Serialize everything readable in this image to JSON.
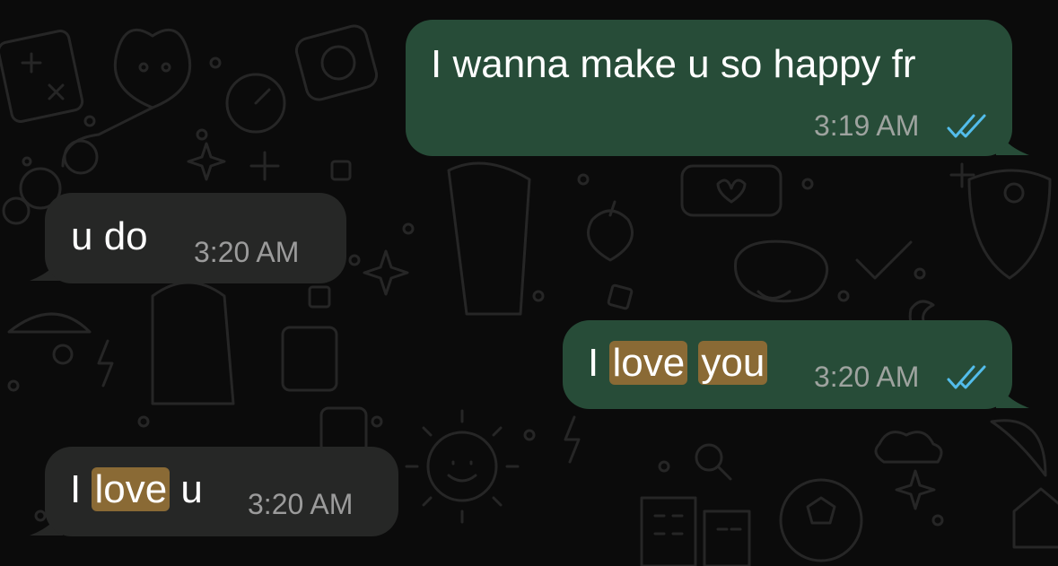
{
  "messages": [
    {
      "direction": "outgoing",
      "text": "I wanna make u so happy fr",
      "time": "3:19 AM",
      "status": "read"
    },
    {
      "direction": "incoming",
      "text": "u do",
      "time": "3:20 AM"
    },
    {
      "direction": "outgoing",
      "parts": [
        "I",
        "love",
        "you"
      ],
      "highlighted": [
        "love",
        "you"
      ],
      "time": "3:20 AM",
      "status": "read"
    },
    {
      "direction": "incoming",
      "parts": [
        "I",
        "love",
        "u"
      ],
      "highlighted": [
        "love"
      ],
      "time": "3:20 AM"
    }
  ],
  "colors": {
    "background": "#0b0b0b",
    "outgoing_bubble": "#274c38",
    "incoming_bubble": "#262726",
    "search_highlight": "#8a6a35",
    "read_ticks": "#53bdeb"
  },
  "icons": {
    "read_receipt": "double-check-icon"
  }
}
